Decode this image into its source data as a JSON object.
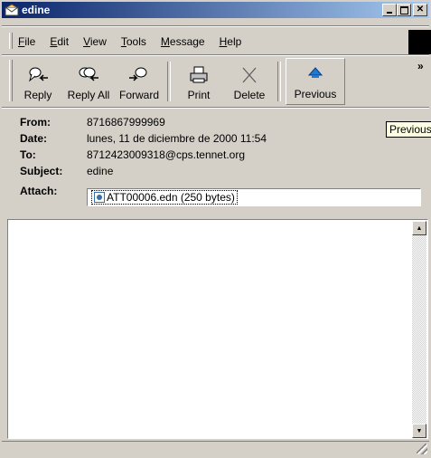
{
  "window": {
    "title": "edine"
  },
  "menu": [
    {
      "label": "File",
      "u": "F",
      "rest": "ile"
    },
    {
      "label": "Edit",
      "u": "E",
      "rest": "dit"
    },
    {
      "label": "View",
      "u": "V",
      "rest": "iew"
    },
    {
      "label": "Tools",
      "u": "T",
      "rest": "ools"
    },
    {
      "label": "Message",
      "u": "M",
      "rest": "essage"
    },
    {
      "label": "Help",
      "u": "H",
      "rest": "elp"
    }
  ],
  "toolbar": {
    "reply": "Reply",
    "reply_all": "Reply All",
    "forward": "Forward",
    "print": "Print",
    "delete": "Delete",
    "previous": "Previous",
    "more": "»"
  },
  "headers": {
    "from_label": "From:",
    "from": "8716867999969",
    "date_label": "Date:",
    "date": "lunes, 11 de diciembre de 2000 11:54",
    "to_label": "To:",
    "to": "8712423009318@cps.tennet.org",
    "subject_label": "Subject:",
    "subject": "edine",
    "attach_label": "Attach:",
    "attachment": "ATT00006.edn (250 bytes)"
  },
  "tooltip": "Previous",
  "colors": {
    "titlebar_start": "#0a246a",
    "titlebar_end": "#a6caf0",
    "face": "#d4d0c8"
  }
}
